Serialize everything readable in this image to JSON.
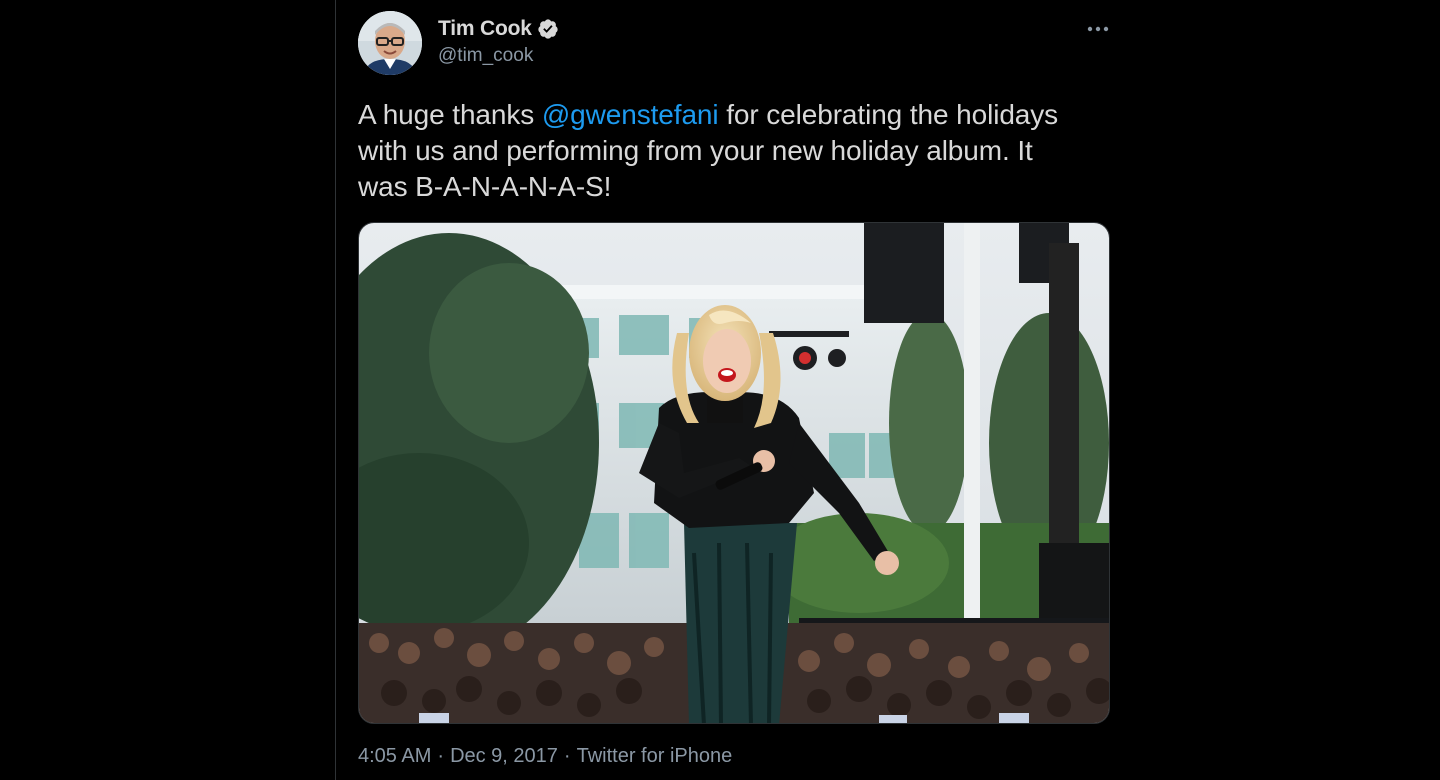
{
  "tweet": {
    "author": {
      "display_name": "Tim Cook",
      "handle": "@tim_cook",
      "verified": true,
      "avatar_icon": "profile-photo"
    },
    "text": {
      "prefix": "A huge thanks ",
      "mention": "@gwenstefani",
      "suffix": " for celebrating the holidays with us and performing from your new holiday album. It was B-A-N-A-N-A-S!"
    },
    "media": {
      "type": "photo",
      "icon": "performer-photo"
    },
    "meta": {
      "time": "4:05 AM",
      "separator": "·",
      "date": "Dec 9, 2017",
      "source": "Twitter for iPhone"
    },
    "more_icon": "more-horizontal-icon"
  },
  "colors": {
    "background": "#000000",
    "text": "#d9d9d9",
    "secondary": "#8b98a5",
    "link": "#1d9bf0",
    "divider": "#2f3336"
  }
}
